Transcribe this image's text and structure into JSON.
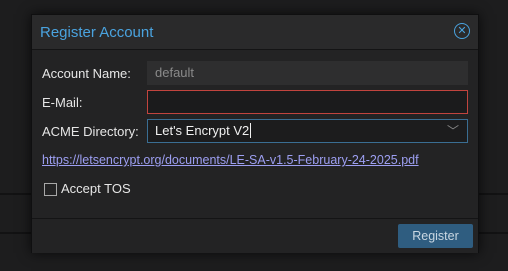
{
  "dialog": {
    "title": "Register Account",
    "close_icon": "close-circle-icon",
    "accent_color": "#4aa3df"
  },
  "form": {
    "account_name": {
      "label": "Account Name:",
      "value": "default"
    },
    "email": {
      "label": "E-Mail:",
      "value": "",
      "border_color": "#c2443e"
    },
    "acme_directory": {
      "label": "ACME Directory:",
      "selected": "Let's Encrypt V2",
      "caret_icon": "chevron-down-icon"
    },
    "tos_link": "https://letsencrypt.org/documents/LE-SA-v1.5-February-24-2025.pdf",
    "accept_tos": {
      "label": "Accept TOS",
      "checked": false
    }
  },
  "footer": {
    "register_label": "Register"
  }
}
